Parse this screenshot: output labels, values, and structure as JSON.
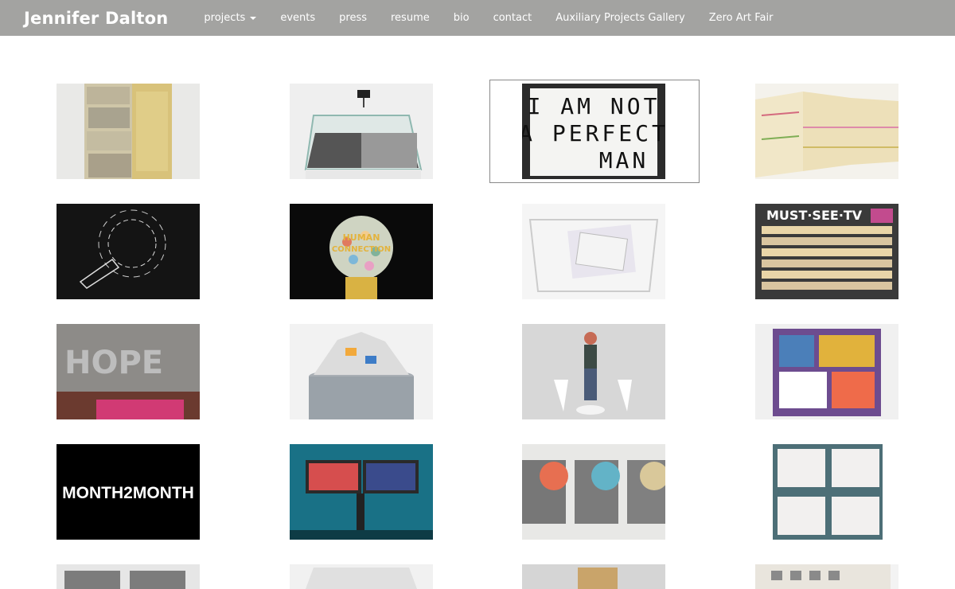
{
  "site": {
    "brand": "Jennifer Dalton"
  },
  "nav": {
    "items": [
      {
        "label": "projects",
        "dropdown": true
      },
      {
        "label": "events"
      },
      {
        "label": "press"
      },
      {
        "label": "resume"
      },
      {
        "label": "bio"
      },
      {
        "label": "contact"
      },
      {
        "label": "Auxiliary Projects Gallery"
      },
      {
        "label": "Zero Art Fair"
      }
    ]
  },
  "gallery": {
    "selected_index": 2,
    "thumb_texts": {
      "perfect_line1": "I AM NOT",
      "perfect_line2": "A PERFECT",
      "perfect_line3": "MAN",
      "hope": "HOPE",
      "month": "MONTH2MONTH",
      "mustsee": "MUST·SEE·TV",
      "human": "HUMAN",
      "connection": "CONNECTION"
    },
    "thumbnails": [
      {
        "subject": "stacked-bundles-sculpture"
      },
      {
        "subject": "glass-case-with-shredded-money"
      },
      {
        "subject": "lightbox-sign"
      },
      {
        "subject": "handwritten-card-accordion"
      },
      {
        "subject": "chalk-drawing-on-black"
      },
      {
        "subject": "gumball-machine"
      },
      {
        "subject": "wire-basket-with-notes"
      },
      {
        "subject": "tv-schedule-chart"
      },
      {
        "subject": "hope-wall-text"
      },
      {
        "subject": "trash-bin-overflowing"
      },
      {
        "subject": "figurine-with-angels"
      },
      {
        "subject": "painted-briefcase"
      },
      {
        "subject": "month2month-title"
      },
      {
        "subject": "monitors-on-stage"
      },
      {
        "subject": "tape-dispensers"
      },
      {
        "subject": "napkin-grid"
      },
      {
        "subject": "row5-item1"
      },
      {
        "subject": "row5-item2"
      },
      {
        "subject": "row5-item3"
      },
      {
        "subject": "row5-item4"
      }
    ]
  }
}
